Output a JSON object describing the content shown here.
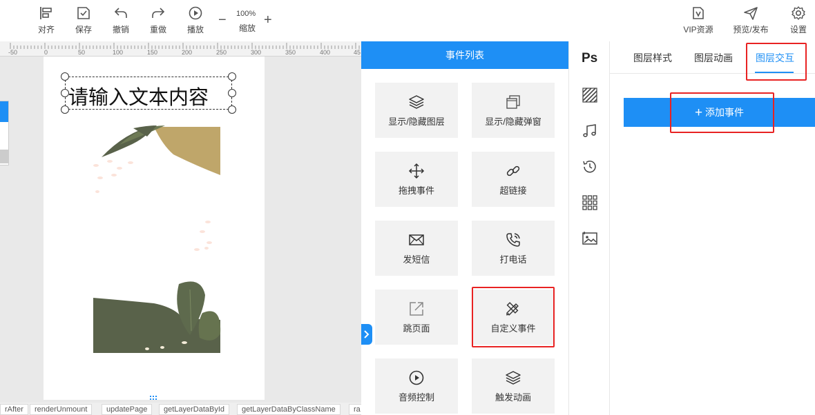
{
  "toolbar": {
    "left": [
      {
        "label": "对齐",
        "icon": "align-icon"
      },
      {
        "label": "保存",
        "icon": "save-icon"
      },
      {
        "label": "撤销",
        "icon": "undo-icon"
      },
      {
        "label": "重做",
        "icon": "redo-icon"
      },
      {
        "label": "播放",
        "icon": "play-icon"
      }
    ],
    "zoom": {
      "value": "100%",
      "label": "缩放",
      "minus": "−",
      "plus": "+"
    },
    "right": [
      {
        "label": "VIP资源",
        "icon": "vip-resource-icon"
      },
      {
        "label": "预览/发布",
        "icon": "send-icon"
      },
      {
        "label": "设置",
        "icon": "gear-icon"
      }
    ]
  },
  "canvas": {
    "ruler_labels": [
      "-50",
      "0",
      "50",
      "100",
      "150",
      "200",
      "250",
      "300",
      "350",
      "400",
      "45"
    ],
    "text_element": "请输入文本内容",
    "method_chips": [
      "rAfter",
      "renderUnmount",
      "updatePage",
      "getLayerDataById",
      "getLayerDataByClassName",
      "ra"
    ]
  },
  "events_panel": {
    "title": "事件列表",
    "items": [
      {
        "label": "显示/隐藏图层",
        "icon": "layers-icon"
      },
      {
        "label": "显示/隐藏弹窗",
        "icon": "windows-icon"
      },
      {
        "label": "拖拽事件",
        "icon": "move-icon"
      },
      {
        "label": "超链接",
        "icon": "link-icon"
      },
      {
        "label": "发短信",
        "icon": "mail-icon"
      },
      {
        "label": "打电话",
        "icon": "phone-icon"
      },
      {
        "label": "跳页面",
        "icon": "external-link-icon"
      },
      {
        "label": "自定义事件",
        "icon": "custom-tools-icon"
      },
      {
        "label": "音频控制",
        "icon": "play-circle-icon"
      },
      {
        "label": "触发动画",
        "icon": "layers-trigger-icon"
      }
    ]
  },
  "icon_strip": {
    "ps_label": "Ps",
    "icons": [
      "texture-icon",
      "music-icon",
      "history-icon",
      "grid-icon",
      "image-icon"
    ]
  },
  "right_panel": {
    "tabs": [
      "图层样式",
      "图层动画",
      "图层交互"
    ],
    "active_tab": "图层交互",
    "add_event_label": "添加事件",
    "add_event_icon": "plus-icon"
  },
  "colors": {
    "accent": "#1e8ff5",
    "highlight_red": "#e82222",
    "card_bg": "#f2f2f2",
    "leaf_dark": "#59624a",
    "sand": "#bfa66a"
  }
}
